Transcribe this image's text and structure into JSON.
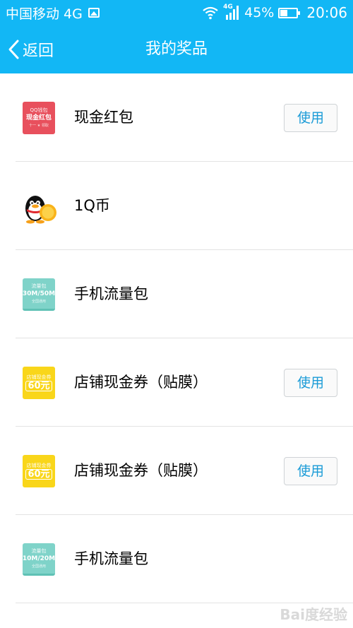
{
  "status_bar": {
    "carrier": "中国移动 4G",
    "network_badge": "4G",
    "battery": "45%",
    "battery_level": 0.45,
    "time": "20:06",
    "icons": [
      "image-icon",
      "wifi-icon",
      "signal-icon",
      "battery-icon"
    ]
  },
  "nav": {
    "back_label": "返回",
    "title": "我的奖品"
  },
  "prizes": [
    {
      "name": "现金红包",
      "thumb": {
        "style": "red",
        "line1": "QQ钱包",
        "line2": "现金红包",
        "line3": "十一 ★ 领取"
      },
      "action": "使用"
    },
    {
      "name": "1Q币",
      "thumb": {
        "style": "penguin"
      },
      "action": ""
    },
    {
      "name": "手机流量包",
      "thumb": {
        "style": "teal",
        "line1": "流量包",
        "line2": "30M/50M",
        "line3": "全国通用"
      },
      "action": ""
    },
    {
      "name": "店铺现金券（贴膜）",
      "thumb": {
        "style": "yellow",
        "line1": "店铺现金券",
        "line2": "60元",
        "line3": ""
      },
      "action": "使用"
    },
    {
      "name": "店铺现金券（贴膜）",
      "thumb": {
        "style": "yellow",
        "line1": "店铺现金券",
        "line2": "60元",
        "line3": ""
      },
      "action": "使用"
    },
    {
      "name": "手机流量包",
      "thumb": {
        "style": "teal",
        "line1": "流量包",
        "line2": "10M/20M",
        "line3": "全国通用"
      },
      "action": ""
    }
  ],
  "watermark": "Bai度经验",
  "colors": {
    "header": "#12b7f5",
    "button_text": "#1a9bd7",
    "divider": "#e3e3e3"
  }
}
